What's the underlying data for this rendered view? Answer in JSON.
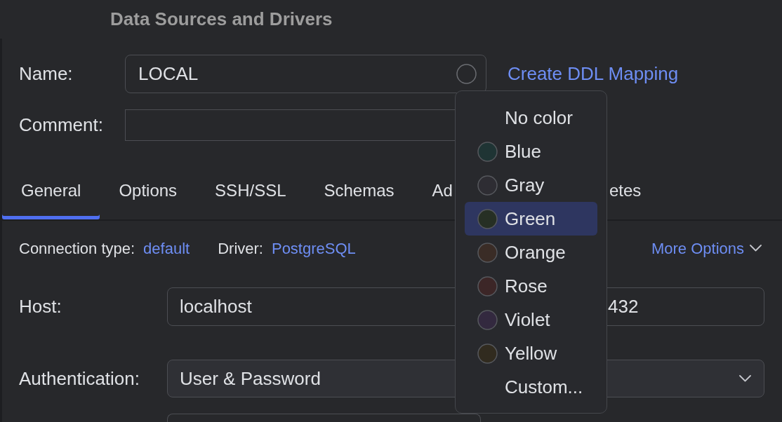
{
  "window": {
    "title": "Data Sources and Drivers"
  },
  "name_field": {
    "label": "Name:",
    "value": "LOCAL"
  },
  "ddl_link": "Create DDL Mapping",
  "comment_field": {
    "label": "Comment:"
  },
  "tabs": [
    {
      "label": "General",
      "selected": true,
      "kind": "full"
    },
    {
      "label": "Options",
      "selected": false,
      "kind": "full"
    },
    {
      "label": "SSH/SSL",
      "selected": false,
      "kind": "full"
    },
    {
      "label": "Schemas",
      "selected": false,
      "kind": "full"
    },
    {
      "label": "Ad",
      "selected": false,
      "kind": "cut_end"
    },
    {
      "label": "etes",
      "selected": false,
      "kind": "cut_start"
    }
  ],
  "connection": {
    "type_label": "Connection type:",
    "type_value": "default",
    "driver_label": "Driver:",
    "driver_value": "PostgreSQL",
    "more_options": "More Options"
  },
  "form_rows": [
    {
      "kind": "host",
      "label": "Host:",
      "value": "localhost",
      "port_value": "432"
    },
    {
      "kind": "select",
      "label": "Authentication:",
      "value": "User & Password"
    },
    {
      "kind": "blank"
    }
  ],
  "color_menu": {
    "items": [
      {
        "label": "No color",
        "selected": false
      },
      {
        "label": "Blue",
        "color": "#1f3434",
        "selected": false
      },
      {
        "label": "Gray",
        "color": "#2e2d33",
        "selected": false
      },
      {
        "label": "Green",
        "color": "#262f24",
        "selected": true
      },
      {
        "label": "Orange",
        "color": "#3a2c26",
        "selected": false
      },
      {
        "label": "Rose",
        "color": "#3c2627",
        "selected": false
      },
      {
        "label": "Violet",
        "color": "#33293f",
        "selected": false
      },
      {
        "label": "Yellow",
        "color": "#312b1f",
        "selected": false
      },
      {
        "label": "Custom...",
        "selected": false
      }
    ]
  }
}
